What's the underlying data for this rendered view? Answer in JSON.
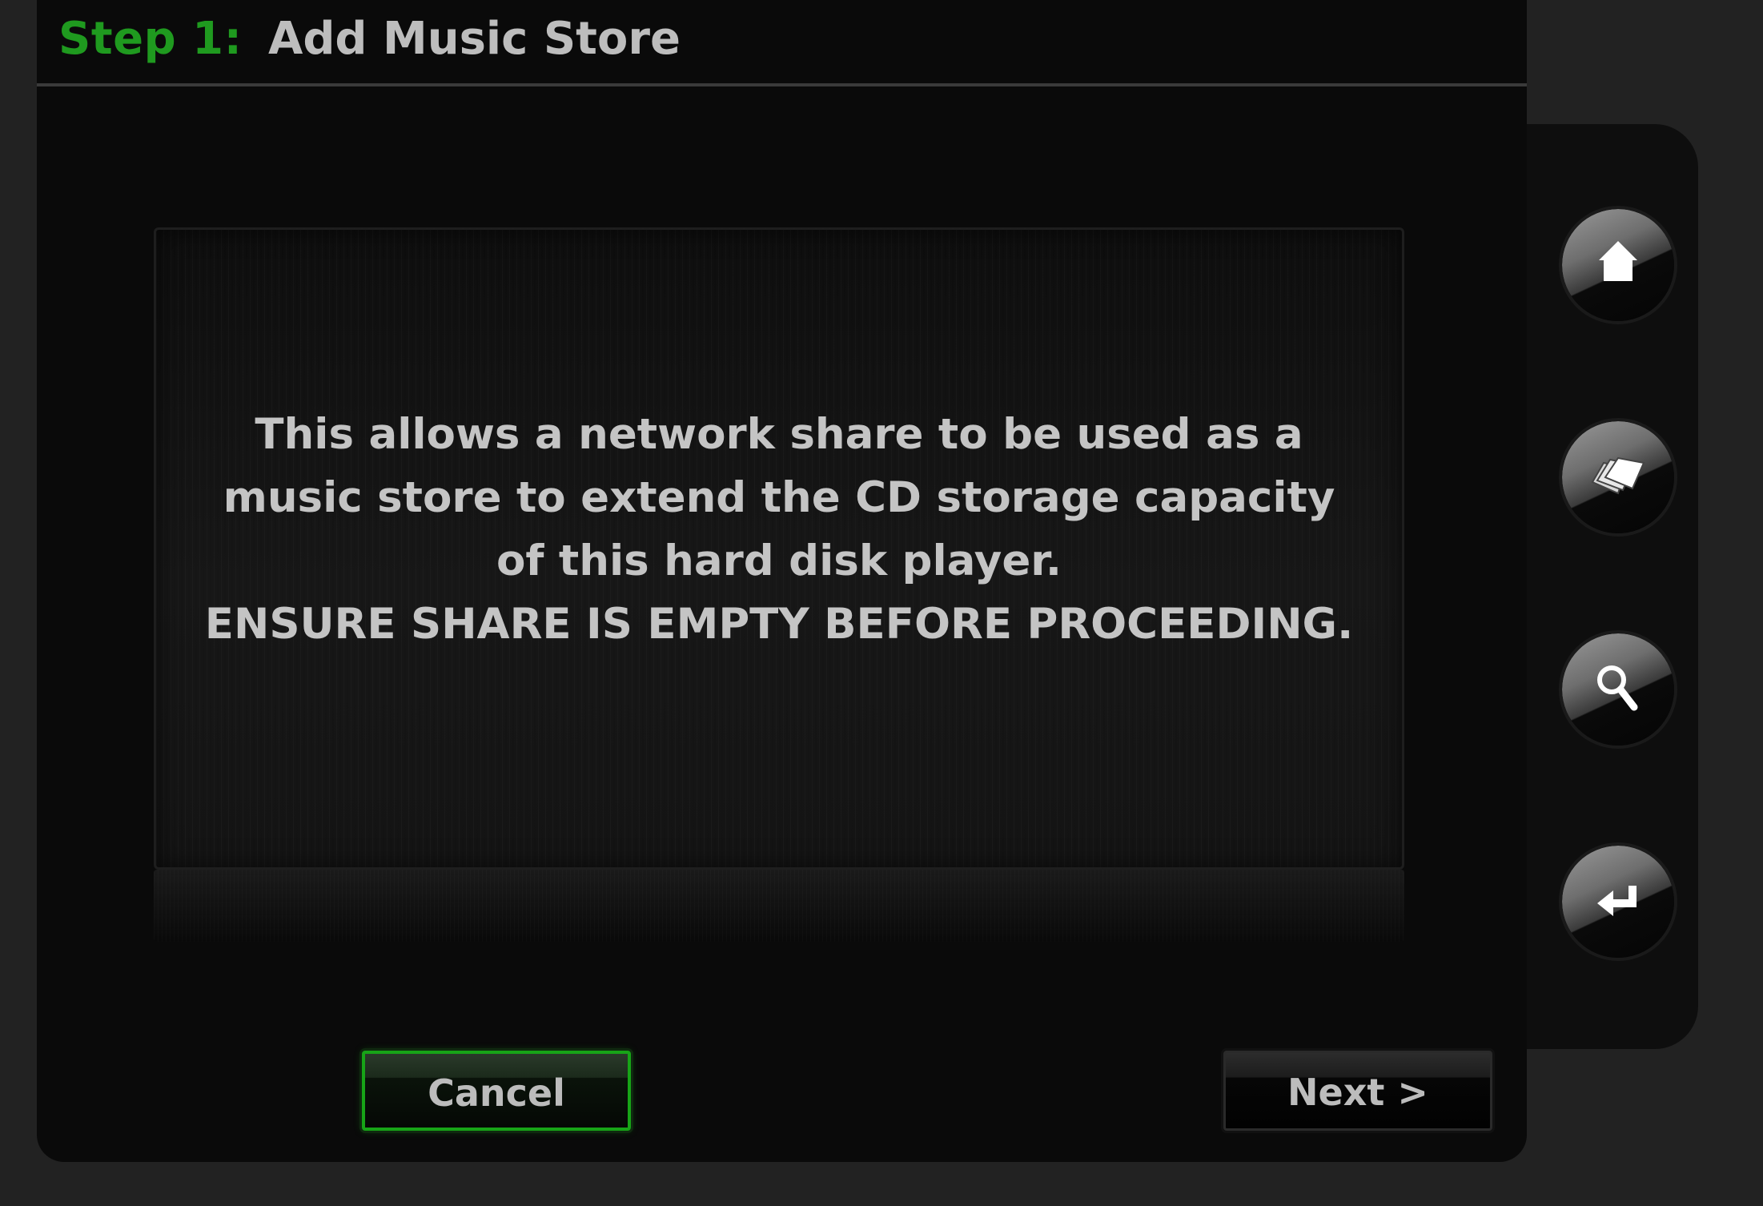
{
  "header": {
    "step_label": "Step 1:",
    "title": "Add Music Store"
  },
  "message": {
    "lines": [
      "This allows a network share to be used as a",
      "music store to extend the CD storage capacity",
      "of this hard disk player.",
      "ENSURE SHARE IS EMPTY BEFORE PROCEEDING."
    ]
  },
  "buttons": {
    "cancel_label": "Cancel",
    "next_label": "Next >"
  },
  "sidebar": {
    "items": [
      {
        "icon": "home-icon"
      },
      {
        "icon": "cd-stack-icon"
      },
      {
        "icon": "search-icon"
      },
      {
        "icon": "return-icon"
      }
    ]
  },
  "colors": {
    "accent": "#1f9a1f",
    "text": "#c4c4c4",
    "background": "#222222",
    "panel": "#0a0a0a"
  }
}
